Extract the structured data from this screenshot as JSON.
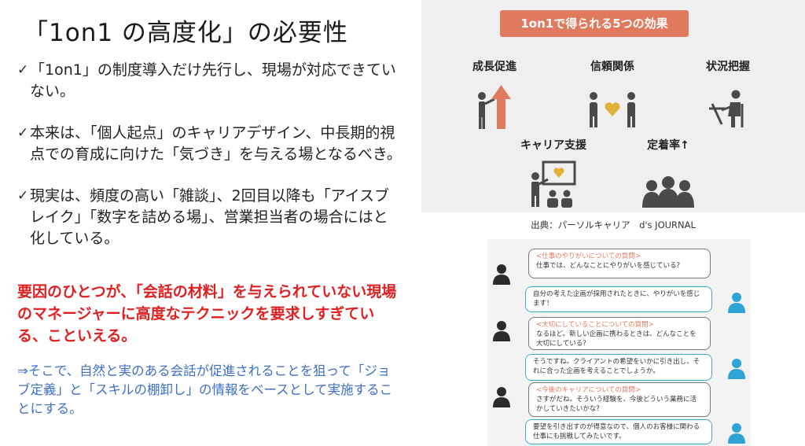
{
  "title": "「1on1 の高度化」の必要性",
  "bullets": [
    "「1on1」の制度導入だけ先行し、現場が対応できていない。",
    "本来は、「個人起点」のキャリアデザイン、中長期的視点での育成に向けた「気づき」を与える場となるべき。",
    "現実は、頻度の高い「雑談」、2回目以降も「アイスブレイク」「数字を詰める場」、営業担当者の場合にはと化している。"
  ],
  "check_mark": "✓",
  "emphasis": "要因のひとつが、「会話の材料」を与えられていない現場のマネージャーに高度なテクニックを要求しすぎている、こといえる。",
  "proposal": "⇒そこで、自然と実のある会話が促進されることを狙って「ジョブ定義」と「スキルの棚卸し」の情報をベースとして実施することにする。",
  "effects": {
    "banner": "1on1で得られる5つの効果",
    "items": [
      {
        "label": "成長促進",
        "icon": "growth-arrow-person-icon"
      },
      {
        "label": "信頼関係",
        "icon": "two-people-heart-icon"
      },
      {
        "label": "状況把握",
        "icon": "person-at-desk-icon"
      },
      {
        "label": "キャリア支援",
        "icon": "presenter-board-icon"
      },
      {
        "label": "定着率↑",
        "icon": "group-people-icon"
      }
    ],
    "accent": "#e07a5f",
    "heart_color": "#e0b23a"
  },
  "source": "出典：パーソルキャリア　d's JOURNAL",
  "chat": [
    {
      "side": "left",
      "q": "<仕事のやりがいについての質問>",
      "a": "仕事では、どんなことにやりがいを感じている？"
    },
    {
      "side": "right",
      "a": "自分の考えた企画が採用されたときに、やりがいを感じます！"
    },
    {
      "side": "left",
      "q": "<大切にしていることについての質問>",
      "a": "なるほど。新しい企画に携わるときは、どんなことを大切にしている？"
    },
    {
      "side": "right",
      "a": "そうですね。クライアントの希望をいかに引き出し、それに合った企画を考えることでしょうか。"
    },
    {
      "side": "left",
      "q": "<今後のキャリアについての質問>",
      "a": "さすがだね。そういう経験を、今後どういう業務に活かしていきたいかな？"
    },
    {
      "side": "right",
      "a": "要望を引き出すのが得意なので、個人のお客様に関わる仕事にも挑戦してみたいです。"
    }
  ]
}
